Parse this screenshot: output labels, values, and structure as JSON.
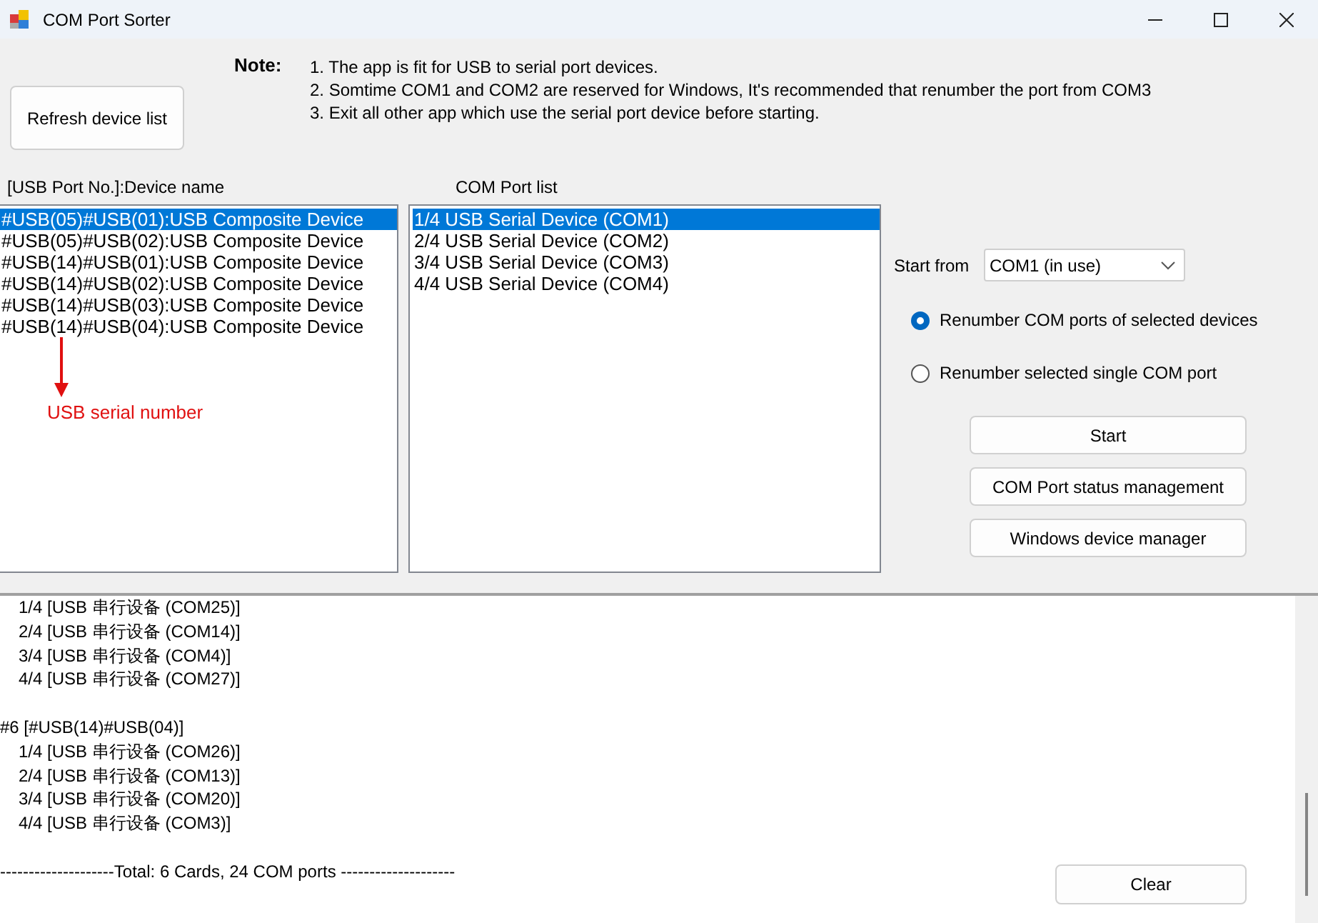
{
  "window": {
    "title": "COM Port Sorter"
  },
  "refresh_button": "Refresh device list",
  "note": {
    "label": "Note:",
    "lines": [
      "1. The app is fit for USB to serial port devices.",
      "2. Somtime COM1 and COM2 are reserved for Windows, It's recommended that renumber the port from COM3",
      "3. Exit all other app which use the serial port device before starting."
    ]
  },
  "device_list": {
    "header": "[USB Port No.]:Device name",
    "items": [
      {
        "text": "#USB(05)#USB(01):USB Composite Device",
        "selected": true
      },
      {
        "text": "#USB(05)#USB(02):USB Composite Device",
        "selected": false
      },
      {
        "text": "#USB(14)#USB(01):USB Composite Device",
        "selected": false
      },
      {
        "text": "#USB(14)#USB(02):USB Composite Device",
        "selected": false
      },
      {
        "text": "#USB(14)#USB(03):USB Composite Device",
        "selected": false
      },
      {
        "text": "#USB(14)#USB(04):USB Composite Device",
        "selected": false
      }
    ]
  },
  "com_port_list": {
    "header": "COM Port list",
    "items": [
      {
        "text": "1/4 USB Serial Device (COM1)",
        "selected": true
      },
      {
        "text": "2/4 USB Serial Device (COM2)",
        "selected": false
      },
      {
        "text": "3/4 USB Serial Device (COM3)",
        "selected": false
      },
      {
        "text": "4/4 USB Serial Device (COM4)",
        "selected": false
      }
    ]
  },
  "annotation": {
    "text": "USB serial number"
  },
  "start_from": {
    "label": "Start from",
    "value": "COM1 (in use)"
  },
  "mode_options": [
    {
      "label": "Renumber COM ports of selected devices",
      "selected": true
    },
    {
      "label": "Renumber selected single COM port",
      "selected": false
    }
  ],
  "buttons": [
    "Start",
    "COM Port status management",
    "Windows device manager"
  ],
  "log": {
    "lines": [
      {
        "kind": "port",
        "text": "1/4 [USB 串行设备 (COM25)]"
      },
      {
        "kind": "port",
        "text": "2/4 [USB 串行设备 (COM14)]"
      },
      {
        "kind": "port",
        "text": "3/4 [USB 串行设备 (COM4)]"
      },
      {
        "kind": "port",
        "text": "4/4 [USB 串行设备 (COM27)]"
      },
      {
        "kind": "blank"
      },
      {
        "kind": "card",
        "text": "#6 [#USB(14)#USB(04)]"
      },
      {
        "kind": "port",
        "text": "1/4 [USB 串行设备 (COM26)]"
      },
      {
        "kind": "port",
        "text": "2/4 [USB 串行设备 (COM13)]"
      },
      {
        "kind": "port",
        "text": "3/4 [USB 串行设备 (COM20)]"
      },
      {
        "kind": "port",
        "text": "4/4 [USB 串行设备 (COM3)]"
      },
      {
        "kind": "blank"
      },
      {
        "kind": "total",
        "text": "--------------------Total: 6 Cards, 24 COM ports --------------------"
      }
    ]
  },
  "clear_button": "Clear"
}
